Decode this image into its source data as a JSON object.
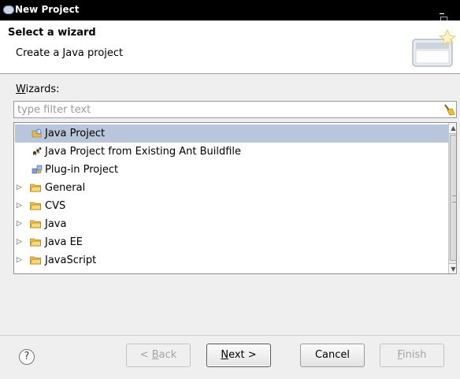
{
  "window": {
    "title": "New Project",
    "controls": "_ □ x"
  },
  "header": {
    "title": "Select a wizard",
    "description": "Create a Java project",
    "banner_icon": "new-wizard-icon"
  },
  "wizards": {
    "label_mnemonic": "W",
    "label_rest": "izards:",
    "filter_placeholder": "type filter text",
    "filter_value": "",
    "clear_icon": "broom-icon",
    "items": [
      {
        "label": "Java Project",
        "icon": "java-project-icon",
        "expandable": false,
        "selected": true
      },
      {
        "label": "Java Project from Existing Ant Buildfile",
        "icon": "ant-icon",
        "expandable": false,
        "selected": false
      },
      {
        "label": "Plug-in Project",
        "icon": "plugin-project-icon",
        "expandable": false,
        "selected": false
      },
      {
        "label": "General",
        "icon": "folder-icon",
        "expandable": true,
        "selected": false
      },
      {
        "label": "CVS",
        "icon": "folder-icon",
        "expandable": true,
        "selected": false
      },
      {
        "label": "Java",
        "icon": "folder-icon",
        "expandable": true,
        "selected": false
      },
      {
        "label": "Java EE",
        "icon": "folder-icon",
        "expandable": true,
        "selected": false
      },
      {
        "label": "JavaScript",
        "icon": "folder-icon",
        "expandable": true,
        "selected": false
      }
    ]
  },
  "buttons": {
    "help": "?",
    "back_prefix": "< ",
    "back_mnemonic": "B",
    "back_rest": "ack",
    "next_mnemonic": "N",
    "next_rest": "ext >",
    "cancel": "Cancel",
    "finish_mnemonic": "F",
    "finish_rest": "inish"
  },
  "colors": {
    "selection": "#b8c5db",
    "folder": "#f5c451",
    "titlebar": "#000000"
  }
}
